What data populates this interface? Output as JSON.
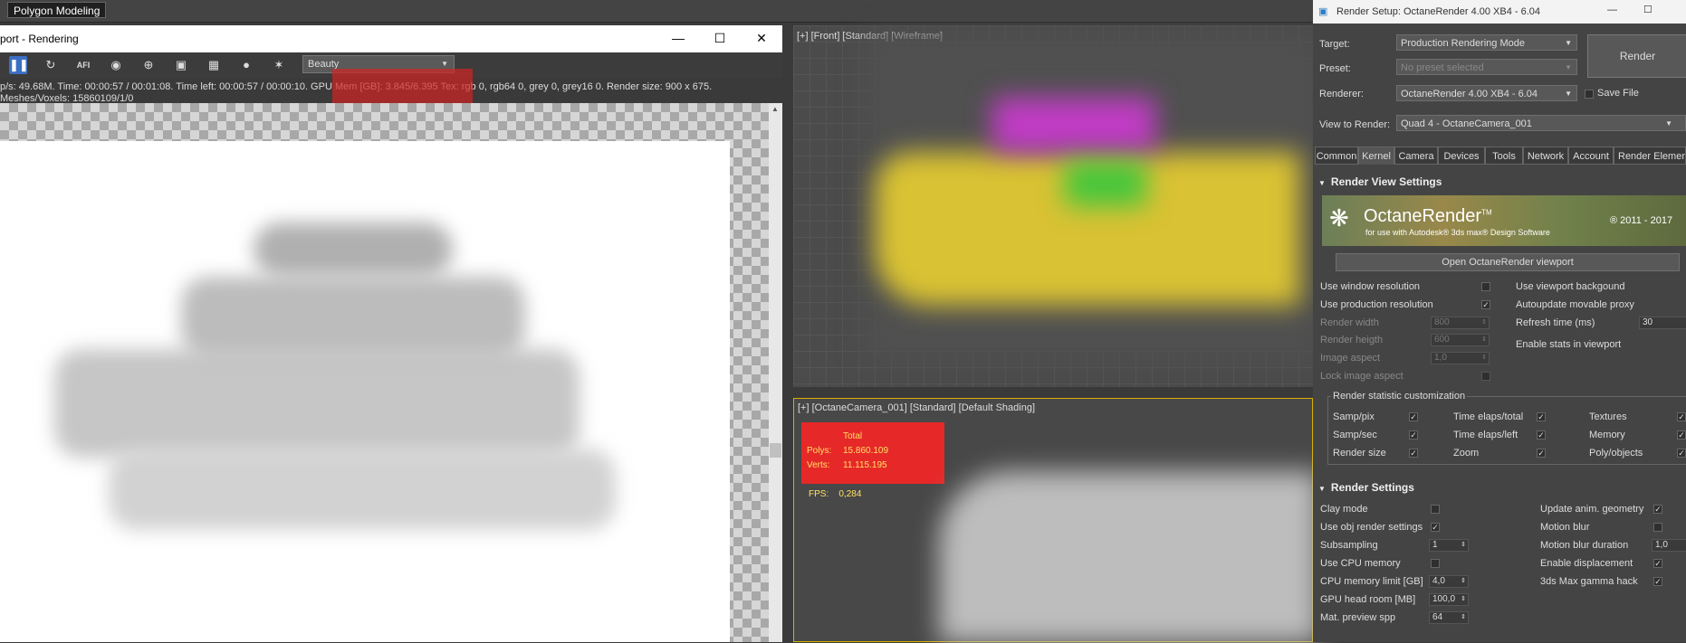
{
  "ribbon": {
    "tab_label": "Polygon Modeling"
  },
  "frame_window": {
    "title": "port - Rendering",
    "pass_select": "Beauty",
    "stats_line1": "p/s: 49.68M.   Time: 00:00:57 / 00:01:08.   Time left: 00:00:57 / 00:00:10.   GPU Mem [GB]: 3.845/6.395   Tex: rgb 0, rgb64 0, grey 0, grey16 0.   Render size: 900 x 675.",
    "stats_line2": "Meshes/Voxels: 15860109/1/0",
    "toolbar_icons": [
      "pause-icon",
      "restart-icon",
      "afi-icon",
      "color-icon",
      "target-icon",
      "monitor-icon",
      "film-icon",
      "camera-icon",
      "settings-icon"
    ],
    "afi_text": "AFI"
  },
  "viewport_front": {
    "label": "[+] [Front] [Standard] [Wireframe]"
  },
  "viewport_camera": {
    "label": "[+] [OctaneCamera_001] [Standard] [Default Shading]",
    "stats_header": "Total",
    "polys_label": "Polys:",
    "polys_value": "15.860.109",
    "verts_label": "Verts:",
    "verts_value": "11.115.195",
    "fps_label": "FPS:",
    "fps_value": "0,284"
  },
  "render_setup": {
    "title": "Render Setup: OctaneRender 4.00 XB4 - 6.04",
    "target_label": "Target:",
    "target_value": "Production Rendering Mode",
    "preset_label": "Preset:",
    "preset_value": "No preset selected",
    "renderer_label": "Renderer:",
    "renderer_value": "OctaneRender 4.00 XB4 - 6.04",
    "save_file_label": "Save File",
    "view_label": "View to Render:",
    "view_value": "Quad 4 - OctaneCamera_001",
    "render_button": "Render",
    "tabs": [
      "Common",
      "Kernel",
      "Camera",
      "Devices",
      "Tools",
      "Network",
      "Account",
      "Render Elements"
    ],
    "section1": "Render View Settings",
    "banner_name": "OctaneRender",
    "banner_tm": "TM",
    "banner_sub": "for use with Autodesk® 3ds max® Design Software",
    "banner_years": "® 2011 - 2017",
    "open_viewport": "Open OctaneRender viewport",
    "use_window_res": "Use window resolution",
    "use_prod_res": "Use production resolution",
    "render_width": "Render width",
    "render_width_val": "800",
    "render_height": "Render heigth",
    "render_height_val": "600",
    "image_aspect": "Image aspect",
    "image_aspect_val": "1,0",
    "lock_aspect": "Lock image aspect",
    "use_vp_bg": "Use viewport backgound",
    "autoupdate": "Autoupdate movable proxy",
    "refresh_time": "Refresh time (ms)",
    "refresh_val": "30",
    "enable_stats": "Enable stats in viewport",
    "stat_group": "Render statistic customization",
    "stat_items": [
      "Samp/pix",
      "Samp/sec",
      "Render size",
      "Time elaps/total",
      "Time elaps/left",
      "Zoom",
      "Textures",
      "Memory",
      "Poly/objects"
    ],
    "section2": "Render Settings",
    "clay_mode": "Clay mode",
    "use_obj": "Use obj render settings",
    "subsampling": "Subsampling",
    "subsampling_val": "1",
    "use_cpu": "Use CPU memory",
    "cpu_limit": "CPU memory limit [GB]",
    "cpu_limit_val": "4,0",
    "gpu_head": "GPU head room [MB]",
    "gpu_head_val": "100,0",
    "mat_preview": "Mat. preview spp",
    "mat_preview_val": "64",
    "update_anim": "Update anim. geometry",
    "motion_blur": "Motion blur",
    "mb_duration": "Motion blur duration",
    "mb_duration_val": "1,0",
    "enable_disp": "Enable displacement",
    "gamma_hack": "3ds Max gamma hack"
  }
}
